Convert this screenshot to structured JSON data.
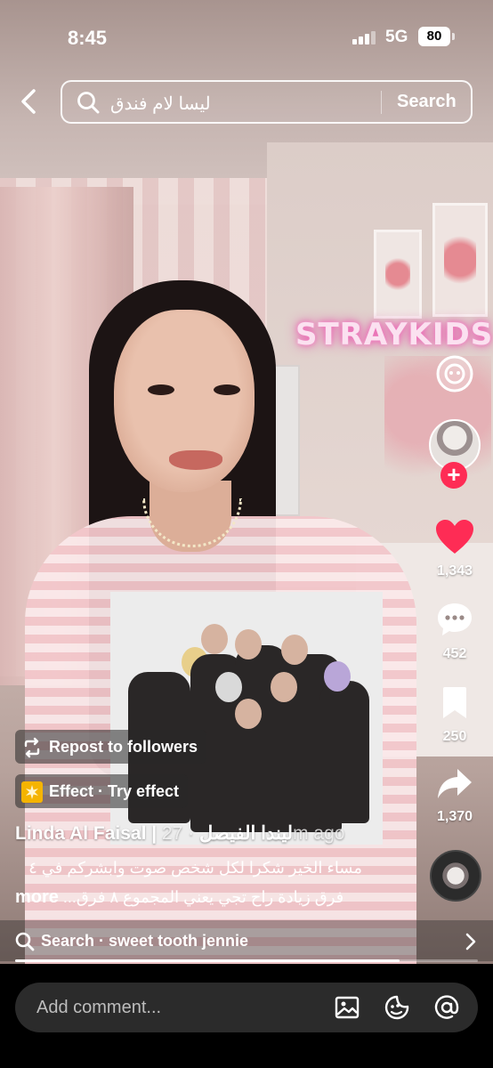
{
  "status_bar": {
    "time": "8:45",
    "network": "5G",
    "battery": "80"
  },
  "search": {
    "query": "ليسا لام فندق",
    "button_label": "Search"
  },
  "sticker": {
    "text": "STRAYKIDS"
  },
  "actions": {
    "likes": "1,343",
    "comments": "452",
    "saves": "250",
    "shares": "1,370"
  },
  "chips": {
    "repost": "Repost to followers",
    "effect": "Effect · Try effect"
  },
  "post": {
    "username": "Linda Al Faisal | ليندا الفيصل",
    "time_ago": " · 27m ago",
    "caption_line1": "مساء الخير  شكرا لكل شخص صوت وابشركم في ٤",
    "caption_more": "more",
    "caption_line2": "فرق  زيادة راح  تجي يعني المجموع ٨ فرق..."
  },
  "related_search": {
    "text": "Search · sweet tooth jennie"
  },
  "video_progress": 0.83,
  "comment": {
    "placeholder": "Add comment..."
  },
  "colors": {
    "like": "#fe2c55",
    "follow": "#fe2c55",
    "neon": "#e048a4"
  }
}
